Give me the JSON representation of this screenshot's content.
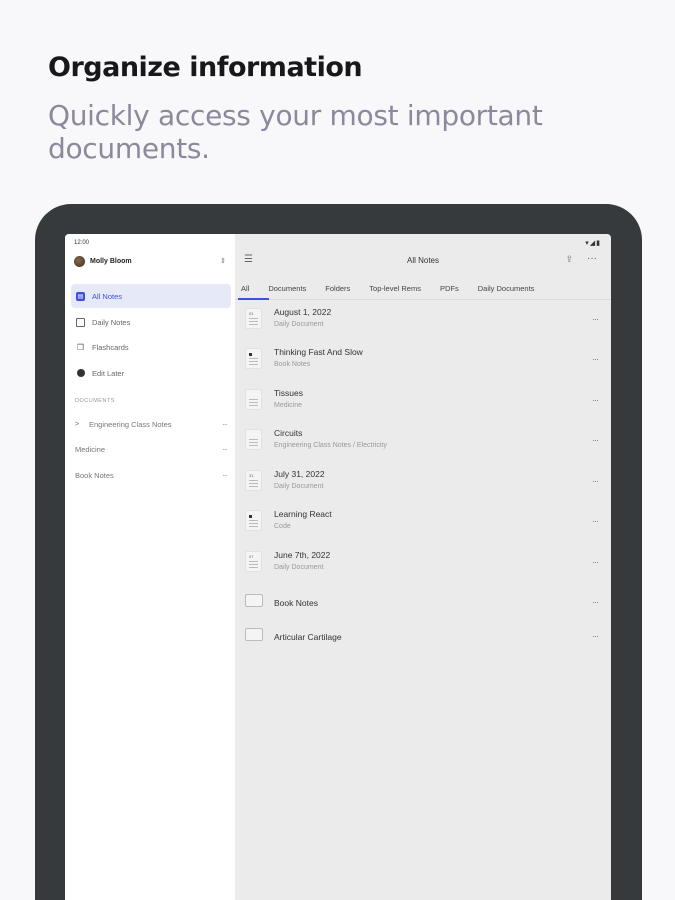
{
  "promo": {
    "headline": "Organize information",
    "subline": "Quickly access your most important documents."
  },
  "status": {
    "time": "12:00",
    "icons": "▾◢▮"
  },
  "sidebar": {
    "user_name": "Molly Bloom",
    "items": [
      {
        "label": "All Notes",
        "icon": "all-notes-icon"
      },
      {
        "label": "Daily Notes",
        "icon": "calendar-icon"
      },
      {
        "label": "Flashcards",
        "icon": "flashcards-icon"
      },
      {
        "label": "Edit Later",
        "icon": "edit-later-icon"
      }
    ],
    "section_label": "DOCUMENTS",
    "documents": [
      {
        "label": "Engineering Class Notes",
        "caret": ">"
      },
      {
        "label": "Medicine",
        "caret": ""
      },
      {
        "label": "Book Notes",
        "caret": ""
      }
    ],
    "more_glyph": "···"
  },
  "main": {
    "title": "All Notes",
    "tabs": [
      "All",
      "Documents",
      "Folders",
      "Top-level Rems",
      "PDFs",
      "Daily Documents"
    ],
    "notes": [
      {
        "title": "August 1, 2022",
        "subtitle": "Daily Document",
        "thumb": "daily",
        "thumb_num": "01"
      },
      {
        "title": "Thinking Fast And Slow",
        "subtitle": "Book Notes",
        "thumb": "doc"
      },
      {
        "title": "Tissues",
        "subtitle": "Medicine",
        "thumb": "plain"
      },
      {
        "title": "Circuits",
        "subtitle": "Engineering Class Notes / Electricity",
        "thumb": "plain"
      },
      {
        "title": "July 31, 2022",
        "subtitle": "Daily Document",
        "thumb": "daily",
        "thumb_num": "31"
      },
      {
        "title": "Learning React",
        "subtitle": "Code",
        "thumb": "doc"
      },
      {
        "title": "June 7th, 2022",
        "subtitle": "Daily Document",
        "thumb": "daily",
        "thumb_num": "07"
      },
      {
        "title": "Book Notes",
        "subtitle": "",
        "thumb": "folder"
      },
      {
        "title": "Articular Cartilage",
        "subtitle": "",
        "thumb": "folder"
      }
    ]
  },
  "colors": {
    "accent": "#3f51d8",
    "device_frame": "#363a3c",
    "page_bg": "#f8f8fa"
  }
}
